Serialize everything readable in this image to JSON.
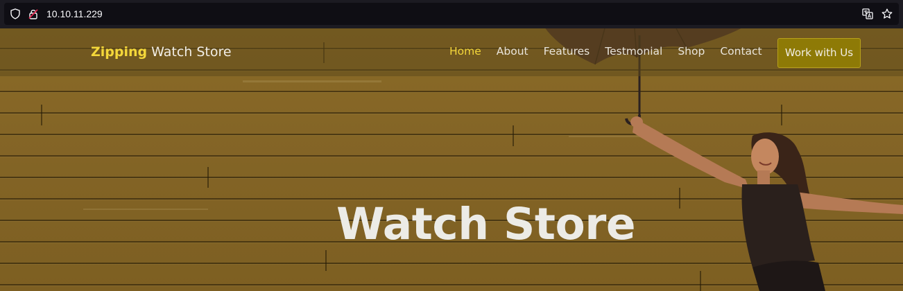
{
  "browser": {
    "url": "10.10.11.229",
    "icons": [
      "shield-icon",
      "insecure-lock-icon",
      "translate-icon",
      "bookmark-star-icon"
    ]
  },
  "site": {
    "brand_accent": "Zipping",
    "brand_rest": " Watch Store",
    "nav": [
      {
        "label": "Home",
        "active": true
      },
      {
        "label": "About",
        "active": false
      },
      {
        "label": "Features",
        "active": false
      },
      {
        "label": "Testmonial",
        "active": false
      },
      {
        "label": "Shop",
        "active": false
      },
      {
        "label": "Contact",
        "active": false
      }
    ],
    "cta_label": "Work with Us",
    "headline": "Watch Store"
  },
  "colors": {
    "accent": "#f4d73a",
    "hero_overlay": "#846526",
    "cta_bg": "#8e7a06"
  }
}
